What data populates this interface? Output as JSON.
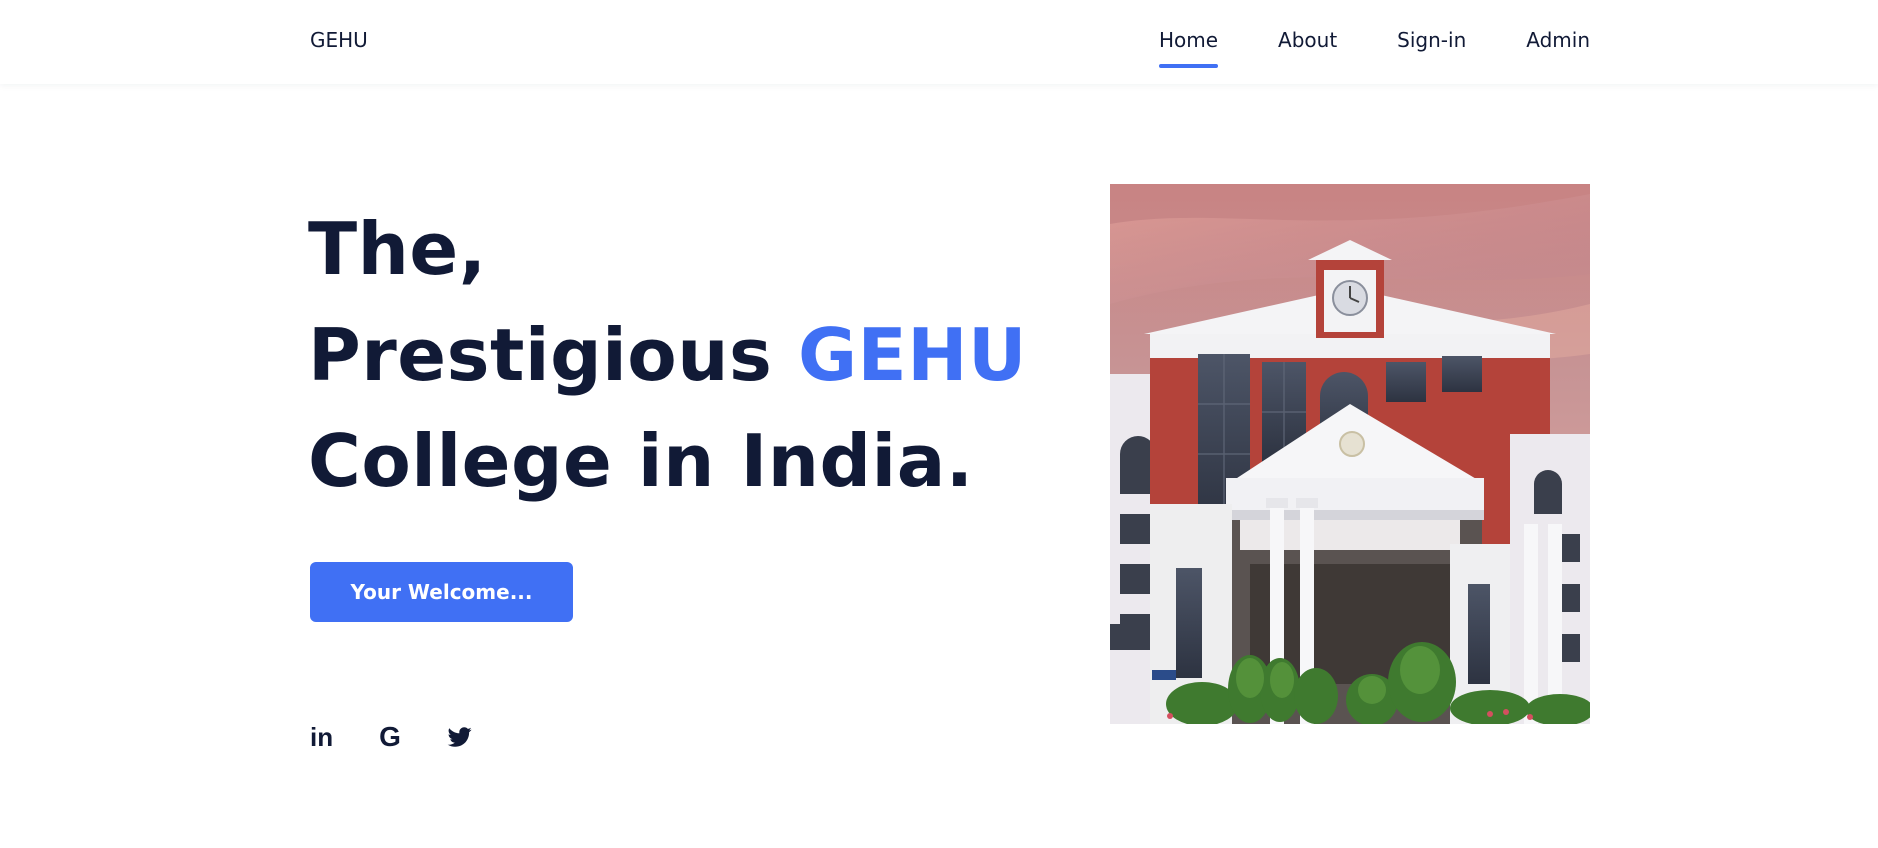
{
  "header": {
    "logo": "GEHU",
    "nav": [
      {
        "label": "Home",
        "active": true
      },
      {
        "label": "About",
        "active": false
      },
      {
        "label": "Sign-in",
        "active": false
      },
      {
        "label": "Admin",
        "active": false
      }
    ]
  },
  "hero": {
    "line1": "The,",
    "line2_prefix": "Prestigious ",
    "line2_accent": "GEHU",
    "line3": "College in India.",
    "cta_label": "Your Welcome..."
  },
  "socials": [
    {
      "icon": "linkedin-icon",
      "glyph": "in"
    },
    {
      "icon": "google-icon",
      "glyph": "G"
    },
    {
      "icon": "twitter-icon"
    }
  ],
  "image": {
    "subject": "college-building-photo"
  },
  "colors": {
    "accent": "#4070f4",
    "text": "#111a36",
    "background": "#ffffff"
  }
}
